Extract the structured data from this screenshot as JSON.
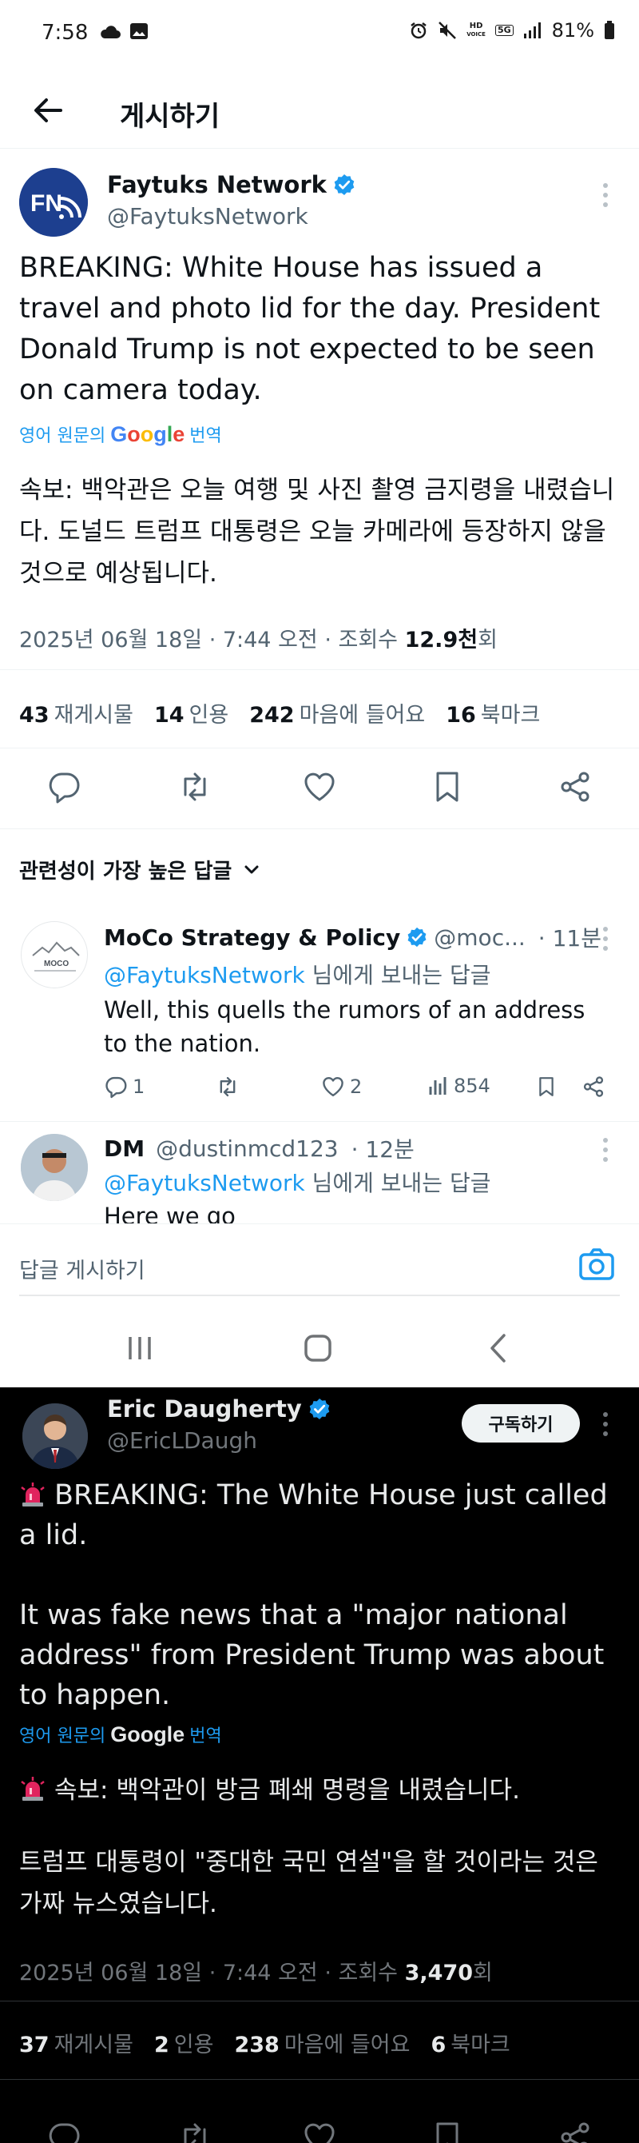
{
  "status_bar": {
    "time": "7:58",
    "battery": "81%",
    "hd_label": "HD",
    "voice_label": "VOICE",
    "fiveg_label": "5G"
  },
  "app_bar": {
    "title": "게시하기"
  },
  "main_post": {
    "author_name": "Faytuks Network",
    "author_handle": "@FaytuksNetwork",
    "avatar_text": "FN",
    "text": "BREAKING: White House has issued a travel and photo lid for the day. President Donald Trump is not expected to be seen on camera today.",
    "translate_prefix": "영어 원문의",
    "translate_brand": "Google",
    "translate_suffix": "번역",
    "translated_text": "속보: 백악관은 오늘 여행 및 사진 촬영 금지령을 내렸습니다. 도널드 트럼프 대통령은 오늘 카메라에 등장하지 않을 것으로 예상됩니다.",
    "date": "2025년 06월 18일 · 7:44 오전 · 조회수 ",
    "views": "12.9천",
    "views_suffix": "회",
    "stats": {
      "reposts": "43",
      "reposts_label": "재게시물",
      "quotes": "14",
      "quotes_label": "인용",
      "likes": "242",
      "likes_label": "마음에 들어요",
      "bookmarks": "16",
      "bookmarks_label": "북마크"
    }
  },
  "sort": {
    "label": "관련성이 가장 높은 답글"
  },
  "replies": [
    {
      "name": "MoCo Strategy & Policy",
      "handle": "@moc...",
      "time": "· 11분",
      "reply_to_handle": "@FaytuksNetwork",
      "reply_to_suffix": "님에게 보내는 답글",
      "text": "Well, this quells the rumors of an address to the nation.",
      "avatar_text": "MOCO",
      "replies_count": "1",
      "likes_count": "2",
      "views_count": "854"
    },
    {
      "name": "DM",
      "handle": "@dustinmcd123",
      "time": "· 12분",
      "reply_to_handle": "@FaytuksNetwork",
      "reply_to_suffix": "님에게 보내는 답글",
      "text": "Here we go"
    }
  ],
  "compose": {
    "placeholder": "답글 게시하기"
  },
  "second_post": {
    "author_name": "Eric Daugherty",
    "author_handle": "@EricLDaugh",
    "follow_label": "구독하기",
    "text_line1": "BREAKING: The White House just called a lid.",
    "text_line2": "It was fake news that a \"major national address\" from President Trump was about to happen.",
    "translate_prefix": "영어 원문의",
    "translate_brand": "Google",
    "translate_suffix": "번역",
    "translated_line1": "속보: 백악관이 방금 폐쇄 명령을 내렸습니다.",
    "translated_line2": "트럼프 대통령이 \"중대한 국민 연설\"을 할 것이라는 것은 가짜 뉴스였습니다.",
    "date": "2025년 06월 18일 · 7:44 오전 · 조회수 ",
    "views": "3,470",
    "views_suffix": "회",
    "stats": {
      "reposts": "37",
      "reposts_label": "재게시물",
      "quotes": "2",
      "quotes_label": "인용",
      "likes": "238",
      "likes_label": "마음에 들어요",
      "bookmarks": "6",
      "bookmarks_label": "북마크"
    }
  },
  "colors": {
    "link_blue": "#1d9bf0",
    "verified_blue": "#1d9bf0",
    "text_dark": "#0f1419",
    "text_muted": "#536471",
    "dark_bg": "#000000",
    "siren_red": "#e0245e"
  }
}
